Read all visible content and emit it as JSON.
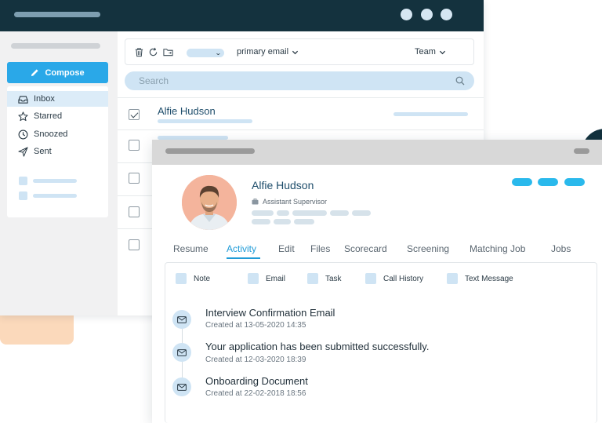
{
  "mail": {
    "compose_label": "Compose",
    "sidebar_items": [
      {
        "label": "Inbox",
        "icon": "inbox-icon"
      },
      {
        "label": "Starred",
        "icon": "star-icon"
      },
      {
        "label": "Snoozed",
        "icon": "clock-icon"
      },
      {
        "label": "Sent",
        "icon": "send-icon"
      }
    ],
    "toolbar": {
      "account_label": "primary email",
      "team_label": "Team"
    },
    "search_placeholder": "Search",
    "rows": [
      {
        "sender": "Alfie Hudson",
        "checked": true
      }
    ]
  },
  "profile": {
    "name": "Alfie Hudson",
    "role": "Assistant Supervisor",
    "tabs": [
      "Resume",
      "Activity",
      "Edit",
      "Files",
      "Scorecard",
      "Screening",
      "Matching Job",
      "Jobs"
    ],
    "active_tab": "Activity",
    "filters": [
      "Note",
      "Email",
      "Task",
      "Call History",
      "Text Message"
    ],
    "activities": [
      {
        "title": "Interview Confirmation Email",
        "time": "Created at 13-05-2020 14:35"
      },
      {
        "title": "Your application has been submitted successfully.",
        "time": "Created at 12-03-2020 18:39"
      },
      {
        "title": "Onboarding Document",
        "time": "Created at 22-02-2018 18:56"
      }
    ]
  },
  "colors": {
    "titlebar": "#14323e",
    "accent": "#2aa8e8",
    "active_tab": "#1f9bd7",
    "light_blue": "#cfe4f4"
  }
}
